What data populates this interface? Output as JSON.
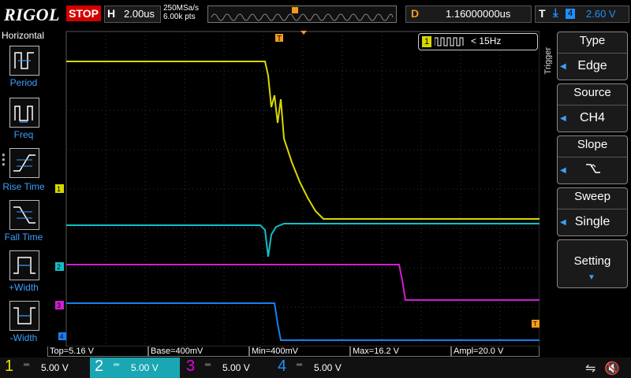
{
  "brand": "RIGOL",
  "run_state": "STOP",
  "horizontal": {
    "label": "H",
    "timebase": "2.00us",
    "sample_rate": "250MSa/s",
    "mem_depth": "6.00k pts"
  },
  "delay": {
    "label": "D",
    "value": "1.16000000us"
  },
  "trigger_status": {
    "label": "T",
    "channel": "4",
    "level": "2.60 V"
  },
  "left_menu": {
    "title": "Horizontal",
    "items": [
      {
        "label": "Period"
      },
      {
        "label": "Freq"
      },
      {
        "label": "Rise Time"
      },
      {
        "label": "Fall Time"
      },
      {
        "label": "+Width"
      },
      {
        "label": "-Width"
      }
    ]
  },
  "freq_badge": {
    "channel": "1",
    "text": "< 15Hz"
  },
  "right_menu": {
    "side_title": "Trigger",
    "items": [
      {
        "title": "Type",
        "value": "Edge"
      },
      {
        "title": "Source",
        "value": "CH4"
      },
      {
        "title": "Slope",
        "value": ""
      },
      {
        "title": "Sweep",
        "value": "Single"
      },
      {
        "title": "Setting",
        "value": ""
      }
    ]
  },
  "markers": {
    "ch1": "1",
    "ch2": "2",
    "ch3": "3",
    "ch4": "4",
    "trig": "T"
  },
  "measurements": [
    {
      "text": "Top=5.16 V"
    },
    {
      "text": "Base=400mV"
    },
    {
      "text": "Min=400mV"
    },
    {
      "text": "Max=16.2 V"
    },
    {
      "text": "Ampl=20.0 V"
    }
  ],
  "channels": [
    {
      "num": "1",
      "scale": "5.00 V",
      "color": "#e6e600"
    },
    {
      "num": "2",
      "scale": "5.00 V",
      "color": "#00e5e5"
    },
    {
      "num": "3",
      "scale": "5.00 V",
      "color": "#e600e6"
    },
    {
      "num": "4",
      "scale": "5.00 V",
      "color": "#1e90ff"
    }
  ],
  "colors": {
    "ch1": "#d8d800",
    "ch2": "#10c0c8",
    "ch3": "#d020d0",
    "ch4": "#1a7ff0",
    "trigger": "#f59b1a"
  }
}
